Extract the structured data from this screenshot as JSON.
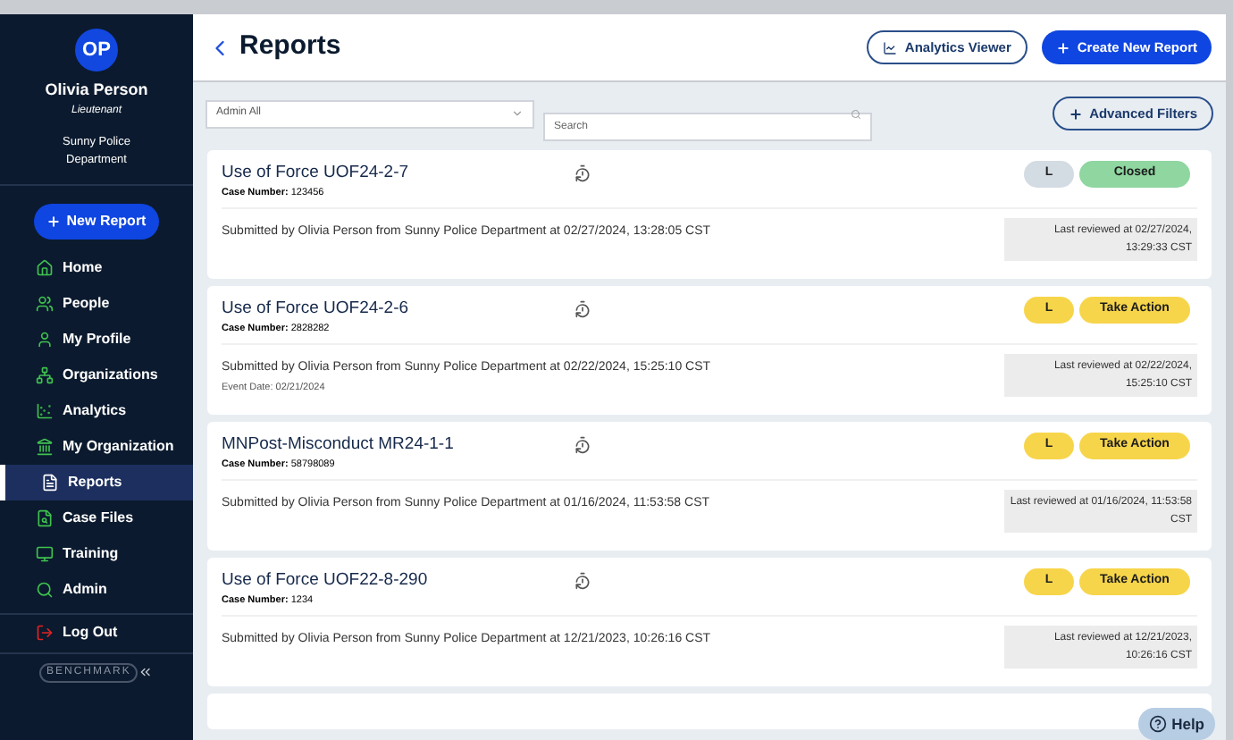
{
  "sidebar": {
    "avatar_initials": "OP",
    "user_name": "Olivia Person",
    "user_role": "Lieutenant",
    "department": "Sunny Police Department",
    "new_report_button": "New Report",
    "items": [
      {
        "label": "Home",
        "selected": false
      },
      {
        "label": "People",
        "selected": false
      },
      {
        "label": "My Profile",
        "selected": false
      },
      {
        "label": "Organizations",
        "selected": false
      },
      {
        "label": "Analytics",
        "selected": false
      },
      {
        "label": "My Organization",
        "selected": false
      },
      {
        "label": "Reports",
        "selected": true
      },
      {
        "label": "Case Files",
        "selected": false
      },
      {
        "label": "Training",
        "selected": false
      },
      {
        "label": "Admin",
        "selected": false
      }
    ],
    "logout": "Log Out",
    "logo_text": "BENCHMARK"
  },
  "header": {
    "title": "Reports",
    "analytics_button": "Analytics Viewer",
    "create_button": "Create New Report"
  },
  "filters": {
    "scope_value": "Admin All",
    "search_placeholder": "Search",
    "advanced_button": "Advanced Filters"
  },
  "reports": [
    {
      "title": "Use of Force UOF24-2-7",
      "case_label": "Case Number:",
      "case_number": "123456",
      "submitted": "Submitted by Olivia Person from Sunny Police Department at 02/27/2024, 13:28:05 CST",
      "last_reviewed": "Last reviewed at 02/27/2024, 13:29:33 CST",
      "level_badge": "L",
      "status": "Closed",
      "kind": "closed"
    },
    {
      "title": "Use of Force UOF24-2-6",
      "case_label": "Case Number:",
      "case_number": "2828282",
      "submitted": "Submitted by Olivia Person from Sunny Police Department at 02/22/2024, 15:25:10 CST",
      "event_date": "Event Date: 02/21/2024",
      "last_reviewed": "Last reviewed at 02/22/2024, 15:25:10 CST",
      "level_badge": "L",
      "status": "Take Action",
      "kind": "action"
    },
    {
      "title": "MNPost-Misconduct MR24-1-1",
      "case_label": "Case Number:",
      "case_number": "58798089",
      "submitted": "Submitted by Olivia Person from Sunny Police Department at 01/16/2024, 11:53:58 CST",
      "last_reviewed": "Last reviewed at 01/16/2024, 11:53:58 CST",
      "level_badge": "L",
      "status": "Take Action",
      "kind": "action"
    },
    {
      "title": "Use of Force UOF22-8-290",
      "case_label": "Case Number:",
      "case_number": "1234",
      "submitted": "Submitted by Olivia Person from Sunny Police Department at 12/21/2023, 10:26:16 CST",
      "last_reviewed": "Last reviewed at 12/21/2023, 10:26:16 CST",
      "level_badge": "L",
      "status": "Take Action",
      "kind": "action"
    }
  ],
  "help_button": "Help"
}
